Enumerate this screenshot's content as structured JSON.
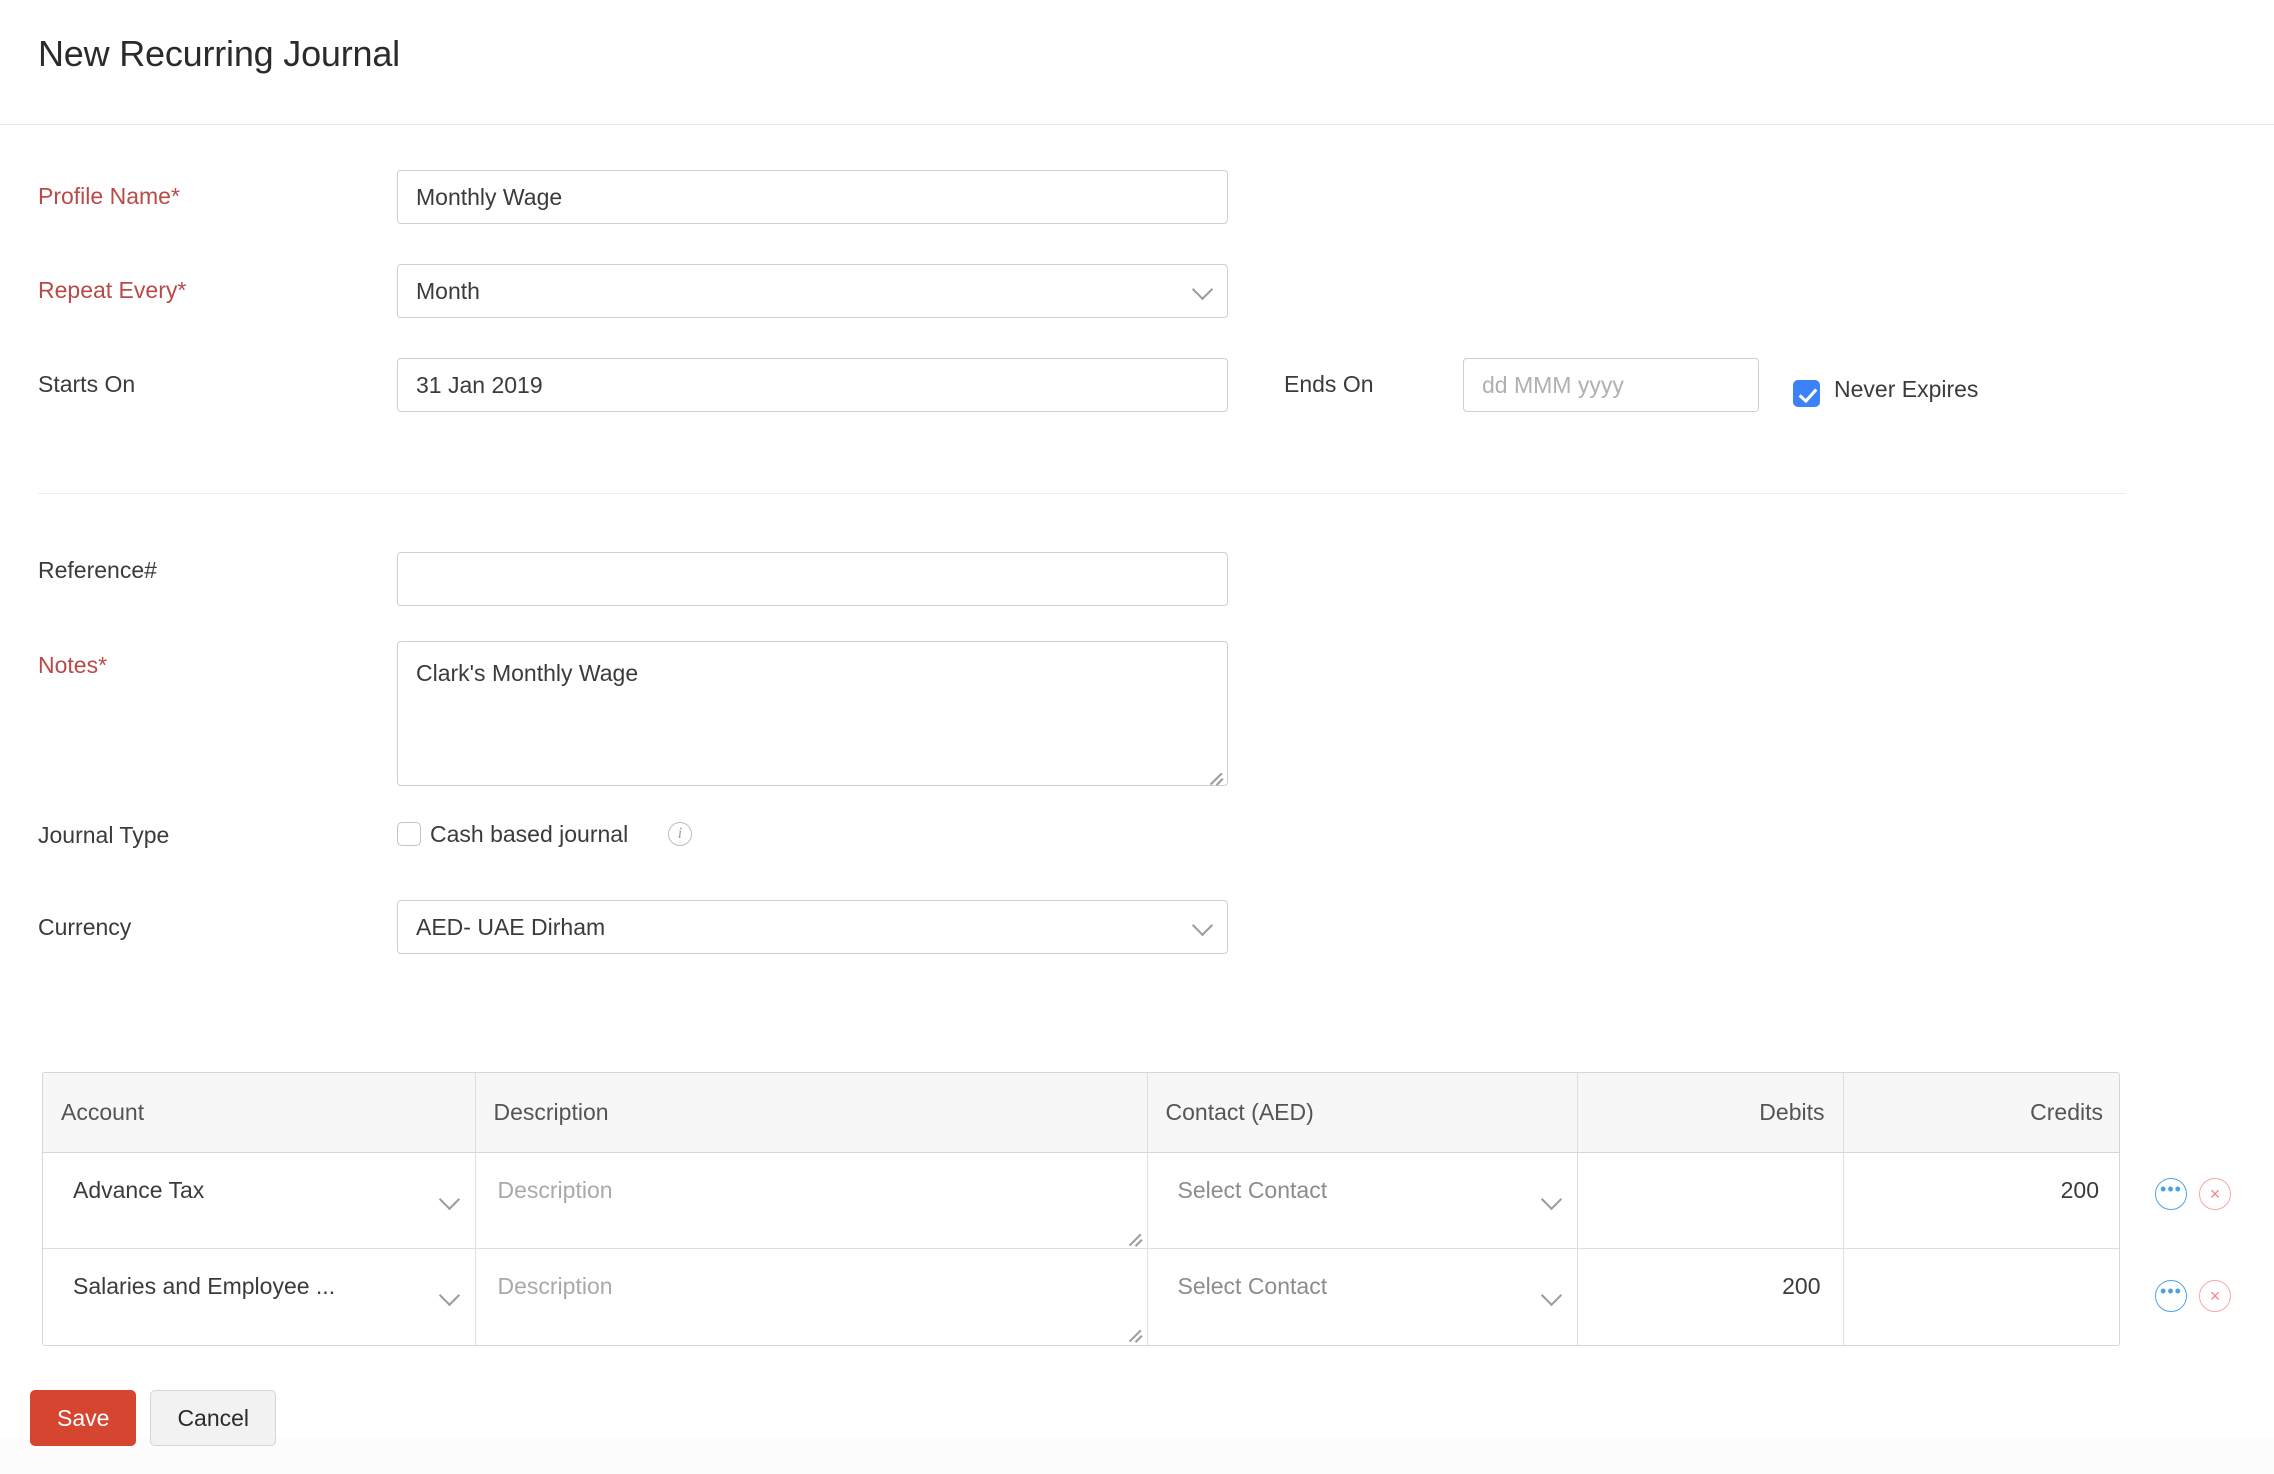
{
  "header": {
    "title": "New Recurring Journal"
  },
  "form": {
    "profile_name": {
      "label": "Profile Name",
      "required_marker": "*",
      "value": "Monthly Wage"
    },
    "repeat_every": {
      "label": "Repeat Every",
      "required_marker": "*",
      "value": "Month"
    },
    "starts_on": {
      "label": "Starts On",
      "value": "31 Jan 2019"
    },
    "ends_on": {
      "label": "Ends On",
      "value": "",
      "placeholder": "dd MMM yyyy"
    },
    "never_expires": {
      "label": "Never Expires",
      "checked": true,
      "color": "#3b82f6"
    },
    "reference": {
      "label": "Reference#",
      "value": "",
      "placeholder": ""
    },
    "notes": {
      "label": "Notes*",
      "value": "Clark's Monthly Wage"
    },
    "journal_type": {
      "label": "Journal Type",
      "checkbox_label": "Cash based journal",
      "checked": false,
      "info_icon": "info-icon",
      "info_glyph": "i"
    },
    "currency": {
      "label": "Currency",
      "value": "AED- UAE Dirham"
    }
  },
  "line_items": {
    "columns": [
      {
        "key": "account",
        "label": "Account",
        "align": "left"
      },
      {
        "key": "description",
        "label": "Description",
        "align": "left"
      },
      {
        "key": "contact",
        "label": "Contact (AED)",
        "align": "left"
      },
      {
        "key": "debits",
        "label": "Debits",
        "align": "right"
      },
      {
        "key": "credits",
        "label": "Credits",
        "align": "right"
      }
    ],
    "rows": [
      {
        "account": "Advance Tax",
        "description": "",
        "description_placeholder": "Description",
        "contact": "Select Contact",
        "debits": "",
        "credits": "200"
      },
      {
        "account": "Salaries and Employee ...",
        "description": "",
        "description_placeholder": "Description",
        "contact": "Select Contact",
        "debits": "200",
        "credits": ""
      }
    ],
    "row_actions": {
      "more_icon": "ellipsis-icon",
      "more_glyph": "•••",
      "delete_icon": "close-circle-icon",
      "delete_glyph": "×",
      "more_color": "#4da3e8",
      "delete_color": "#f08a8a"
    }
  },
  "footer": {
    "save_label": "Save",
    "cancel_label": "Cancel",
    "save_color": "#d6452f"
  }
}
